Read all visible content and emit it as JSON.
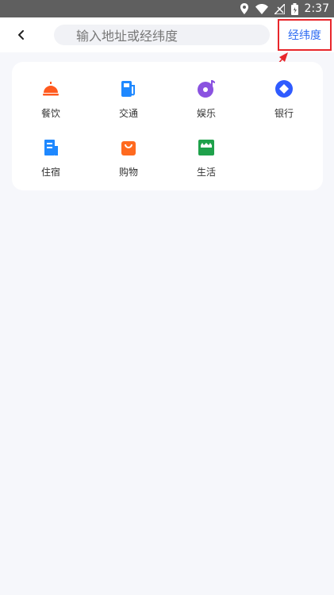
{
  "status": {
    "time": "2:37"
  },
  "header": {
    "search_placeholder": "输入地址或经纬度",
    "latlng_label": "经纬度"
  },
  "categories": [
    {
      "label": "餐饮",
      "icon": "dining-cloche-icon",
      "color": "#ff5a1f"
    },
    {
      "label": "交通",
      "icon": "fuel-pump-icon",
      "color": "#1e88ff"
    },
    {
      "label": "娱乐",
      "icon": "music-disc-icon",
      "color": "#8a52e0"
    },
    {
      "label": "银行",
      "icon": "diamond-coin-icon",
      "color": "#2f5bff"
    },
    {
      "label": "住宿",
      "icon": "hotel-building-icon",
      "color": "#1e88ff"
    },
    {
      "label": "购物",
      "icon": "shopping-bag-icon",
      "color": "#ff6a1f"
    },
    {
      "label": "生活",
      "icon": "storefront-icon",
      "color": "#1fa14b"
    }
  ],
  "colors": {
    "accent": "#2f6cf2",
    "highlight": "#e8262b"
  }
}
